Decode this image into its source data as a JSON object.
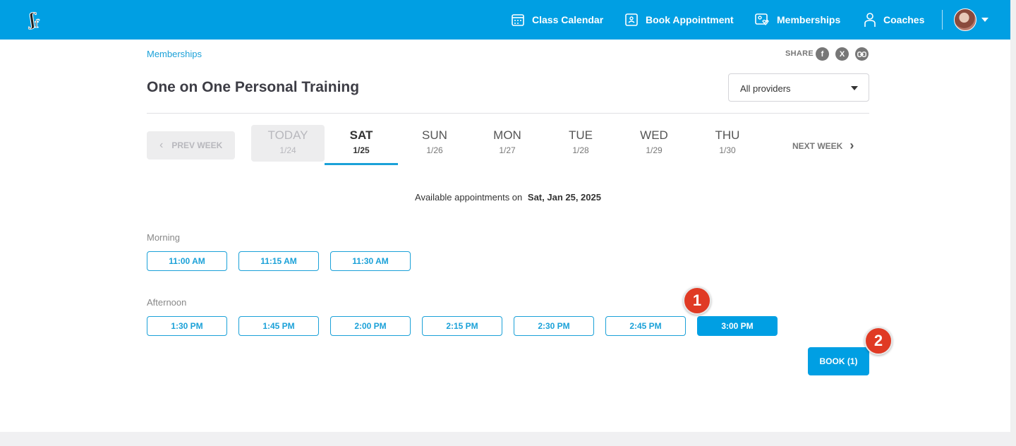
{
  "nav": {
    "items": [
      {
        "label": "Class Calendar",
        "icon": "calendar-icon"
      },
      {
        "label": "Book Appointment",
        "icon": "book-appointment-icon"
      },
      {
        "label": "Memberships",
        "icon": "membership-icon"
      },
      {
        "label": "Coaches",
        "icon": "person-icon"
      }
    ],
    "brand_color": "#009fe3"
  },
  "breadcrumb": "Memberships",
  "share": {
    "label": "SHARE",
    "icons": [
      "facebook-icon",
      "x-icon",
      "link-icon"
    ]
  },
  "page_title": "One on One Personal Training",
  "provider_select": {
    "selected": "All providers"
  },
  "week": {
    "prev_label": "PREV WEEK",
    "next_label": "NEXT WEEK",
    "days": [
      {
        "name": "TODAY",
        "date": "1/24",
        "state": "today"
      },
      {
        "name": "SAT",
        "date": "1/25",
        "state": "selected"
      },
      {
        "name": "SUN",
        "date": "1/26",
        "state": ""
      },
      {
        "name": "MON",
        "date": "1/27",
        "state": ""
      },
      {
        "name": "TUE",
        "date": "1/28",
        "state": ""
      },
      {
        "name": "WED",
        "date": "1/29",
        "state": ""
      },
      {
        "name": "THU",
        "date": "1/30",
        "state": ""
      }
    ]
  },
  "available": {
    "prefix": "Available appointments on",
    "date": "Sat, Jan 25, 2025"
  },
  "morning": {
    "label": "Morning",
    "slots": [
      "11:00 AM",
      "11:15 AM",
      "11:30 AM"
    ]
  },
  "afternoon": {
    "label": "Afternoon",
    "slots": [
      "1:30 PM",
      "1:45 PM",
      "2:00 PM",
      "2:15 PM",
      "2:30 PM",
      "2:45 PM",
      "3:00 PM"
    ],
    "selected": "3:00 PM"
  },
  "book_button": "BOOK (1)",
  "markers": [
    "1",
    "2"
  ]
}
